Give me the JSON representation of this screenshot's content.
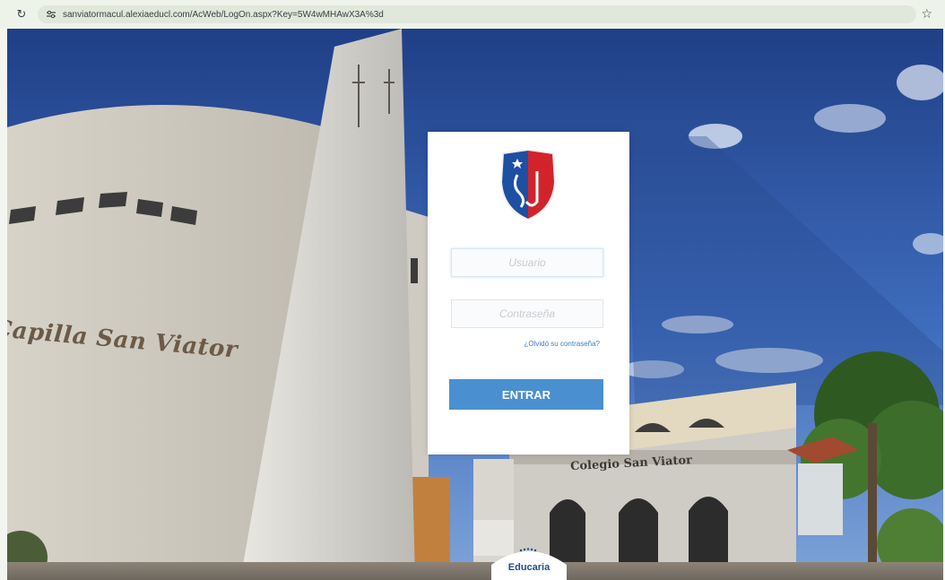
{
  "browser": {
    "url": "sanviatormacul.alexiaeducl.com/AcWeb/LogOn.aspx?Key=5W4wMHAwX3A%3d",
    "reload_icon": "reload-icon",
    "site_info_icon": "site-info-icon",
    "bookmark_icon": "star-icon"
  },
  "background": {
    "chapel_sign": "Capilla San Viator",
    "school_sign": "Colegio San Viator"
  },
  "login": {
    "crest_icon": "school-crest-icon",
    "username_placeholder": "Usuario",
    "password_placeholder": "Contraseña",
    "forgot_password": "¿Olvidó su contraseña?",
    "submit_label": "ENTRAR"
  },
  "footer": {
    "logo_text": "Educaria"
  },
  "colors": {
    "accent": "#4a8fd0",
    "link": "#3b7fc4",
    "crest_blue": "#1d4fa3",
    "crest_red": "#d2232a"
  }
}
